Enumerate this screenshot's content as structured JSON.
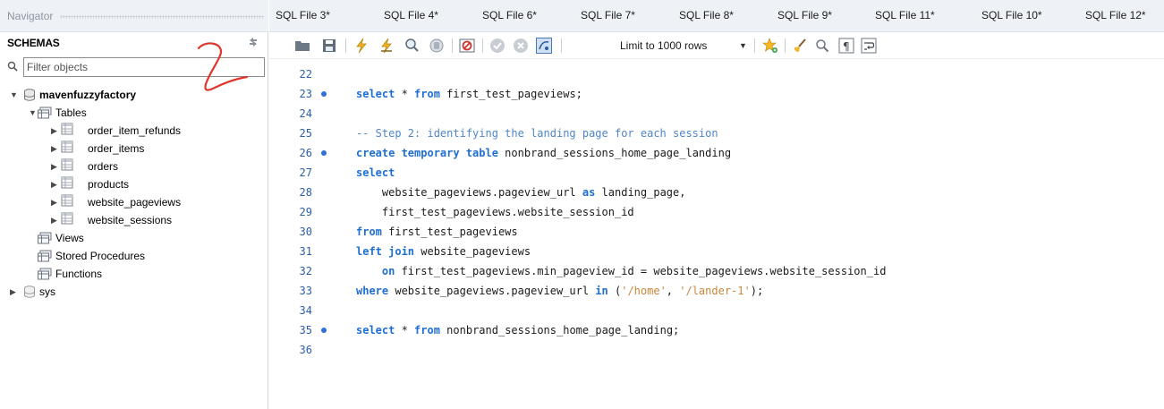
{
  "navigator": {
    "title": "Navigator",
    "schemas_label": "SCHEMAS",
    "filter_placeholder": "Filter objects",
    "tree": {
      "schema1": "mavenfuzzyfactory",
      "tables_folder": "Tables",
      "tables": [
        "order_item_refunds",
        "order_items",
        "orders",
        "products",
        "website_pageviews",
        "website_sessions"
      ],
      "views_folder": "Views",
      "procedures_folder": "Stored Procedures",
      "functions_folder": "Functions",
      "schema2": "sys"
    }
  },
  "editor": {
    "tabs": [
      "SQL File 3*",
      "SQL File 4*",
      "SQL File 6*",
      "SQL File 7*",
      "SQL File 8*",
      "SQL File 9*",
      "SQL File 11*",
      "SQL File 10*",
      "SQL File 12*"
    ],
    "toolbar": {
      "limit_label": "Limit to 1000 rows"
    },
    "line_numbers": [
      "22",
      "23",
      "24",
      "25",
      "26",
      "27",
      "28",
      "29",
      "30",
      "31",
      "32",
      "33",
      "34",
      "35",
      "36"
    ],
    "code": {
      "l23_kw1": "select",
      "l23_txt1": " * ",
      "l23_kw2": "from",
      "l23_txt2": " first_test_pageviews;",
      "l25_comment": "-- Step 2: identifying the landing page for each session",
      "l26_kw": "create temporary table",
      "l26_txt": " nonbrand_sessions_home_page_landing",
      "l27_kw": "select",
      "l28_txt1": "    website_pageviews.pageview_url ",
      "l28_kw": "as",
      "l28_txt2": " landing_page,",
      "l29_txt": "    first_test_pageviews.website_session_id",
      "l30_kw": "from",
      "l30_txt": " first_test_pageviews",
      "l31_kw": "left join",
      "l31_txt": " website_pageviews",
      "l32_indent": "    ",
      "l32_kw": "on",
      "l32_txt": " first_test_pageviews.min_pageview_id = website_pageviews.website_session_id",
      "l33_kw1": "where",
      "l33_txt1": " website_pageviews.pageview_url ",
      "l33_kw2": "in",
      "l33_txt2": " (",
      "l33_str1": "'/home'",
      "l33_txt3": ", ",
      "l33_str2": "'/lander-1'",
      "l33_txt4": ");",
      "l35_kw1": "select",
      "l35_txt1": " * ",
      "l35_kw2": "from",
      "l35_txt2": " nonbrand_sessions_home_page_landing;"
    }
  },
  "colors": {
    "keyword": "#1f6fd1",
    "comment": "#4f86c6",
    "string": "#c7863a",
    "line_number": "#2b5fa8",
    "annotation": "#e0352b"
  }
}
